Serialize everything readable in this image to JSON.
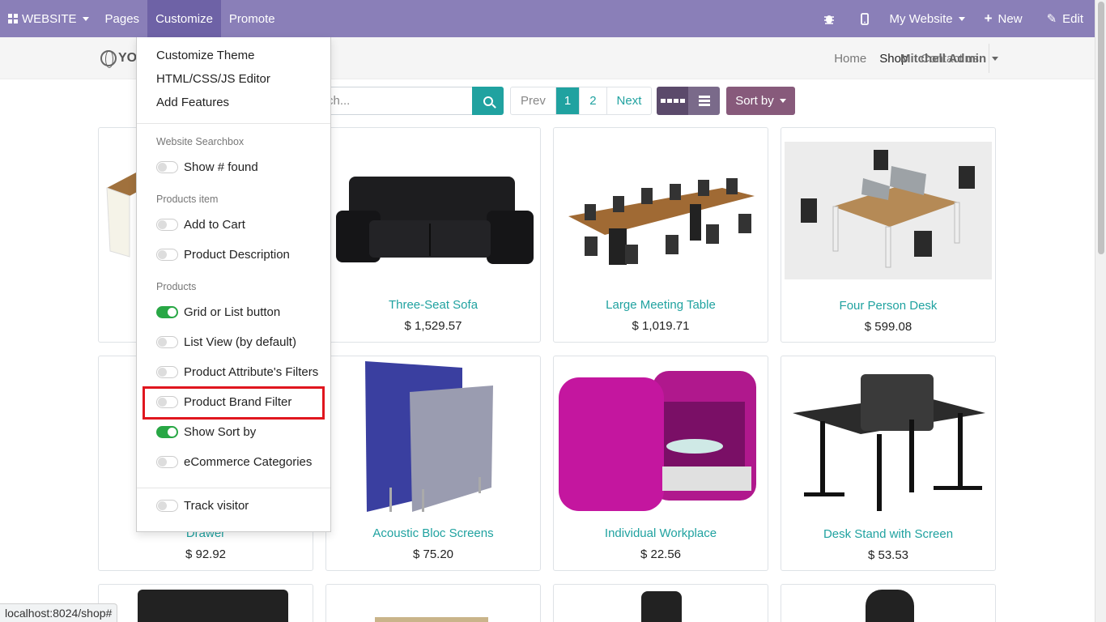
{
  "topbar": {
    "website": "WEBSITE",
    "pages": "Pages",
    "customize": "Customize",
    "promote": "Promote",
    "my_website": "My Website",
    "new": "New",
    "edit": "Edit"
  },
  "header": {
    "logo_text": "YO",
    "nav": [
      "Home",
      "Shop",
      "Contact us"
    ],
    "user": "Mitchell Admin"
  },
  "toolbar": {
    "search_placeholder": "rch...",
    "pager": [
      "Prev",
      "1",
      "2",
      "Next"
    ],
    "sort_label": "Sort by"
  },
  "products": [
    {
      "name": "",
      "price": ""
    },
    {
      "name": "Three-Seat Sofa",
      "price": "$ 1,529.57"
    },
    {
      "name": "Large Meeting Table",
      "price": "$ 1,019.71"
    },
    {
      "name": "Four Person Desk",
      "price": "$ 599.08"
    },
    {
      "name": "Drawer",
      "price": "$ 92.92"
    },
    {
      "name": "Acoustic Bloc Screens",
      "price": "$ 75.20"
    },
    {
      "name": "Individual Workplace",
      "price": "$ 22.56"
    },
    {
      "name": "Desk Stand with Screen",
      "price": "$ 53.53"
    }
  ],
  "customize_menu": {
    "links": [
      "Customize Theme",
      "HTML/CSS/JS Editor",
      "Add Features"
    ],
    "sections": [
      {
        "header": "Website Searchbox",
        "options": [
          {
            "label": "Show # found",
            "on": false
          }
        ]
      },
      {
        "header": "Products item",
        "options": [
          {
            "label": "Add to Cart",
            "on": false
          },
          {
            "label": "Product Description",
            "on": false
          }
        ]
      },
      {
        "header": "Products",
        "options": [
          {
            "label": "Grid or List button",
            "on": true
          },
          {
            "label": "List View (by default)",
            "on": false
          },
          {
            "label": "Product Attribute's Filters",
            "on": false
          },
          {
            "label": "Product Brand Filter",
            "on": false
          },
          {
            "label": "Show Sort by",
            "on": true
          },
          {
            "label": "eCommerce Categories",
            "on": false
          }
        ]
      }
    ],
    "track_visitor": {
      "label": "Track visitor",
      "on": false
    }
  },
  "status_bar": "localhost:8024/shop#",
  "colors": {
    "admin_bar": "#8a7fb8",
    "accent": "#20a2a0",
    "sort": "#875a7b",
    "highlight": "#e0161e"
  }
}
